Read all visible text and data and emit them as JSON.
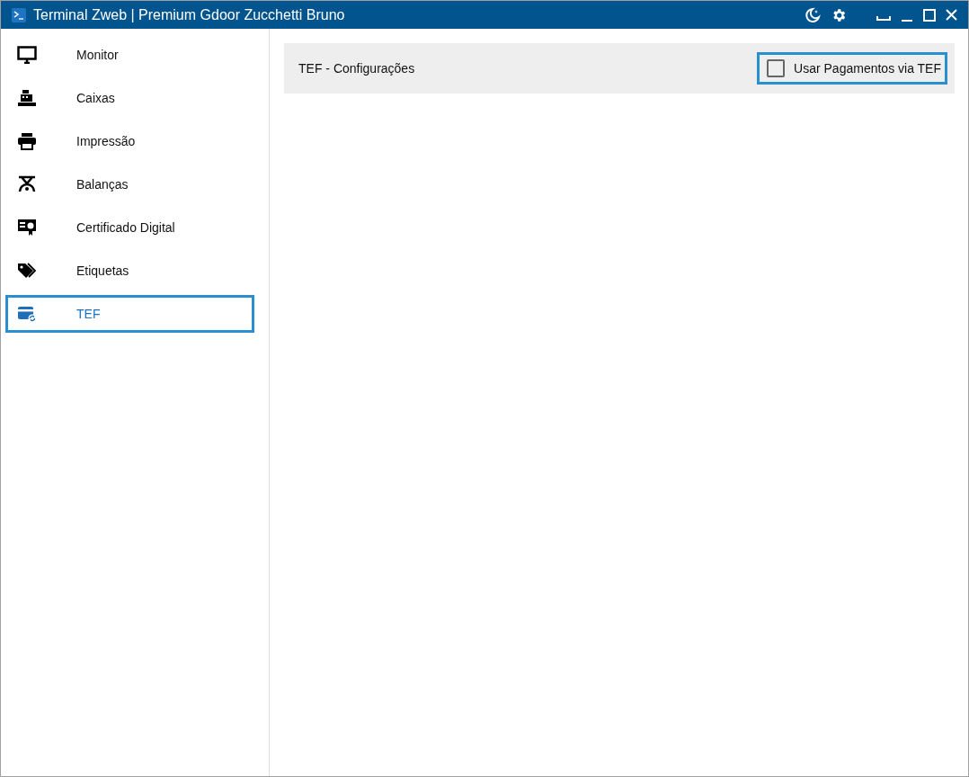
{
  "window": {
    "title": "Terminal Zweb | Premium Gdoor Zucchetti Bruno"
  },
  "sidebar": {
    "items": [
      {
        "label": "Monitor",
        "selected": false
      },
      {
        "label": "Caixas",
        "selected": false
      },
      {
        "label": "Impressão",
        "selected": false
      },
      {
        "label": "Balanças",
        "selected": false
      },
      {
        "label": "Certificado Digital",
        "selected": false
      },
      {
        "label": "Etiquetas",
        "selected": false
      },
      {
        "label": "TEF",
        "selected": true
      }
    ]
  },
  "panel": {
    "title": "TEF - Configurações",
    "option": {
      "label": "Usar Pagamentos via TEF",
      "checked": false
    }
  }
}
